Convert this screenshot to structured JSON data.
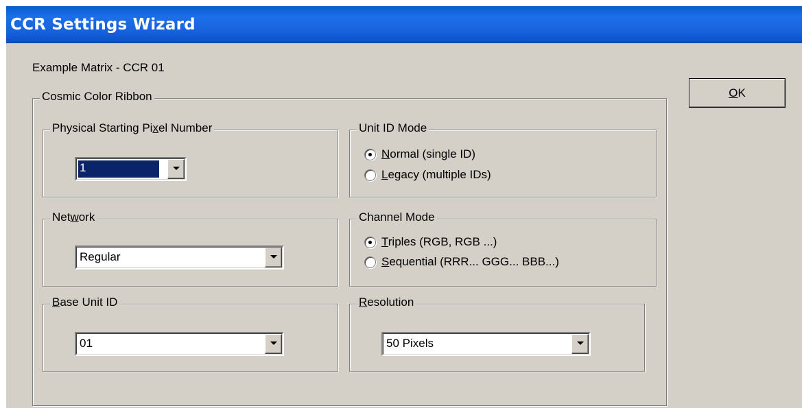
{
  "window": {
    "title": "CCR Settings Wizard"
  },
  "header": {
    "subtitle": "Example Matrix - CCR 01"
  },
  "buttons": {
    "ok_mnemonic": "O",
    "ok_rest": "K"
  },
  "main_group": {
    "label": "Cosmic Color Ribbon"
  },
  "physical_start": {
    "label_pre": "Physical Starting Pi",
    "label_mnemonic": "x",
    "label_post": "el Number",
    "value": "1"
  },
  "unit_id_mode": {
    "label": "Unit ID Mode",
    "options": [
      {
        "mnemonic": "N",
        "rest": "ormal (single ID)",
        "selected": true
      },
      {
        "mnemonic": "L",
        "rest": "egacy (multiple IDs)",
        "selected": false
      }
    ]
  },
  "network": {
    "label_pre": "Net",
    "label_mnemonic": "w",
    "label_post": "ork",
    "value": "Regular"
  },
  "channel_mode": {
    "label": "Channel Mode",
    "options": [
      {
        "mnemonic": "T",
        "rest": "riples (RGB, RGB ...)",
        "selected": true
      },
      {
        "mnemonic": "S",
        "rest": "equential (RRR... GGG... BBB...)",
        "selected": false
      }
    ]
  },
  "base_unit": {
    "label_mnemonic": "B",
    "label_post": "ase Unit ID",
    "value": "01"
  },
  "resolution": {
    "label_mnemonic": "R",
    "label_post": "esolution",
    "value": "50 Pixels"
  },
  "colors": {
    "titlebar": "#1762dc",
    "dialog_bg": "#d4d0c8",
    "selection": "#0a246a"
  }
}
